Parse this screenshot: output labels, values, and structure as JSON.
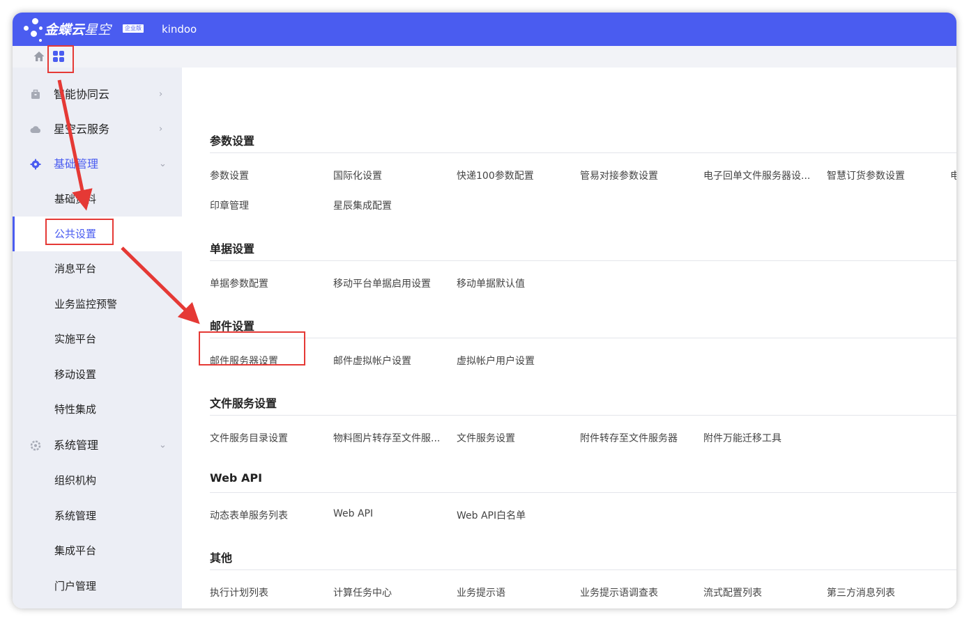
{
  "header": {
    "brand": "金蝶云",
    "brand_sub": "星空",
    "edition": "企业版",
    "tenant": "kindoo"
  },
  "tabbar": {
    "home_icon": "home-icon",
    "apps_icon": "apps-grid-icon"
  },
  "sidebar": {
    "groups": [
      {
        "label": "智能协同云",
        "icon": "briefcase-icon",
        "chevron": "›"
      },
      {
        "label": "星空云服务",
        "icon": "cloud-icon",
        "chevron": "›"
      },
      {
        "label": "基础管理",
        "icon": "gear-icon",
        "chevron": "⌄"
      },
      {
        "label": "系统管理",
        "icon": "system-gear-icon",
        "chevron": "⌄"
      }
    ],
    "basic_items": [
      "基础资料",
      "公共设置",
      "消息平台",
      "业务监控预警",
      "实施平台",
      "移动设置",
      "特性集成"
    ],
    "system_items": [
      "组织机构",
      "系统管理",
      "集成平台",
      "门户管理"
    ]
  },
  "sections": [
    {
      "title": "参数设置",
      "links": [
        "参数设置",
        "国际化设置",
        "快递100参数配置",
        "管易对接参数设置",
        "电子回单文件服务器设...",
        "智慧订货参数设置",
        "电",
        "印章管理",
        "星辰集成配置"
      ]
    },
    {
      "title": "单据设置",
      "links": [
        "单据参数配置",
        "移动平台单据启用设置",
        "移动单据默认值"
      ]
    },
    {
      "title": "邮件设置",
      "links": [
        "邮件服务器设置",
        "邮件虚拟帐户设置",
        "虚拟帐户用户设置"
      ]
    },
    {
      "title": "文件服务设置",
      "links": [
        "文件服务目录设置",
        "物料图片转存至文件服...",
        "文件服务设置",
        "附件转存至文件服务器",
        "附件万能迁移工具"
      ]
    },
    {
      "title": "Web API",
      "links": [
        "动态表单服务列表",
        "Web API",
        "Web API白名单"
      ]
    },
    {
      "title": "其他",
      "links": [
        "执行计划列表",
        "计算任务中心",
        "业务提示语",
        "业务提示语调查表",
        "流式配置列表",
        "第三方消息列表"
      ]
    }
  ],
  "colors": {
    "accent": "#4a5cf0",
    "annotation": "#e53935",
    "sidebar_bg": "#eceef5"
  }
}
